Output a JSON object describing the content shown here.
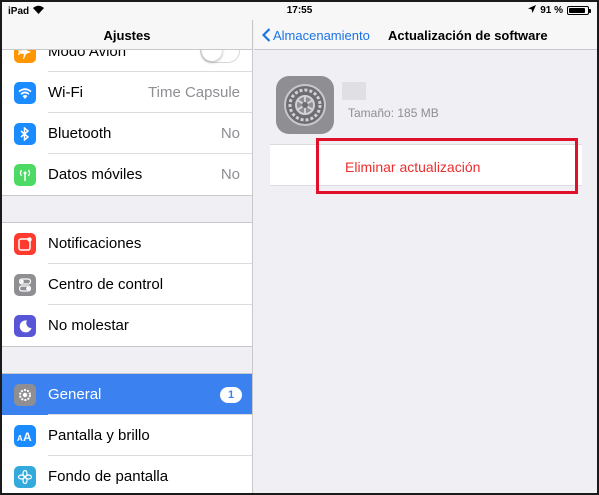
{
  "status_bar": {
    "device": "iPad",
    "time": "17:55",
    "battery": "91 %",
    "battery_level": 0.91
  },
  "master": {
    "title": "Ajustes",
    "group1": [
      {
        "label": "Modo Avión",
        "icon": "airplane-icon",
        "color": "#ff9500",
        "control": "toggle"
      },
      {
        "label": "Wi-Fi",
        "value": "Time Capsule",
        "icon": "wifi-icon",
        "color": "#1a8cff"
      },
      {
        "label": "Bluetooth",
        "value": "No",
        "icon": "bluetooth-icon",
        "color": "#1a8cff"
      },
      {
        "label": "Datos móviles",
        "value": "No",
        "icon": "antenna-icon",
        "color": "#4cd964"
      }
    ],
    "group2": [
      {
        "label": "Notificaciones",
        "icon": "notifications-icon",
        "color": "#ff3b30"
      },
      {
        "label": "Centro de control",
        "icon": "control-center-icon",
        "color": "#8e8e93"
      },
      {
        "label": "No molestar",
        "icon": "moon-icon",
        "color": "#5856d6"
      }
    ],
    "group3": [
      {
        "label": "General",
        "icon": "gear-icon",
        "color": "#8e8e93",
        "badge": "1",
        "selected": true
      },
      {
        "label": "Pantalla y brillo",
        "icon": "text-size-icon",
        "color": "#1a8cff"
      },
      {
        "label": "Fondo de pantalla",
        "icon": "flower-icon",
        "color": "#34aadc"
      }
    ]
  },
  "detail": {
    "back_label": "Almacenamiento",
    "title": "Actualización de software",
    "size": "Tamaño: 185 MB",
    "delete_label": "Eliminar actualización",
    "delete_color": "#ea2f2f",
    "highlight_color": "#e0102a"
  }
}
